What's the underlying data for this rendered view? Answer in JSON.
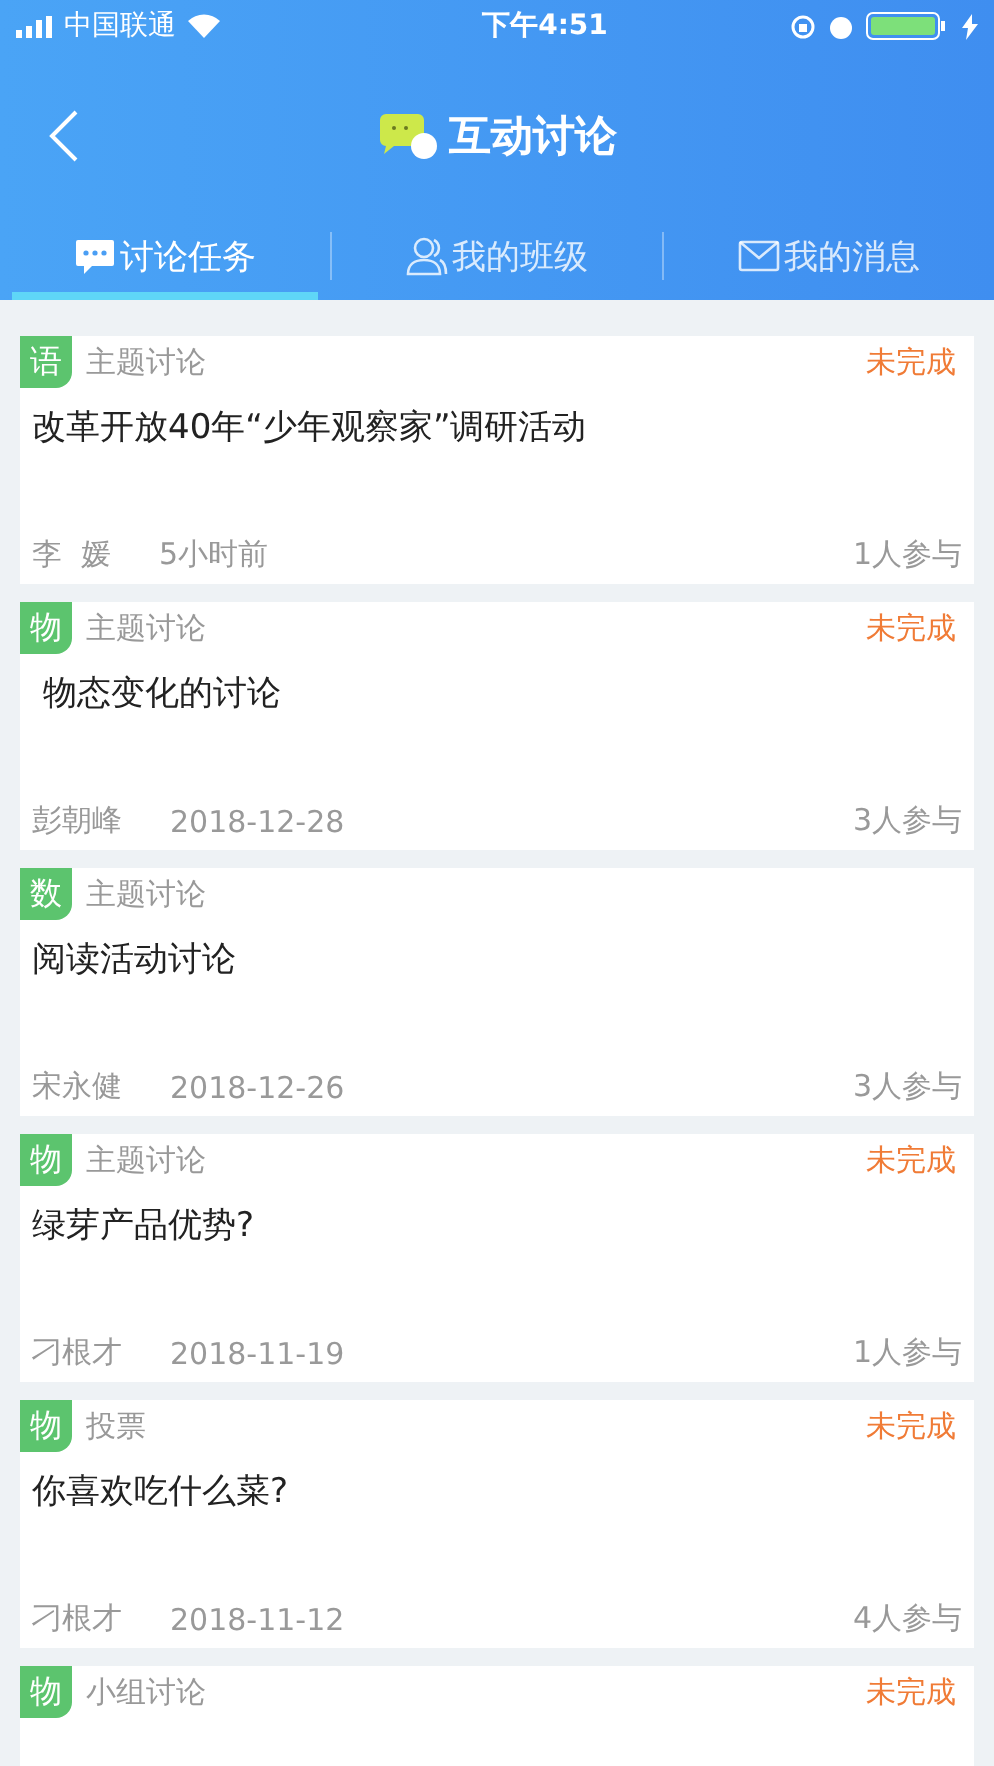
{
  "status_bar": {
    "carrier": "中国联通",
    "time": "下午4:51"
  },
  "header": {
    "title": "互动讨论"
  },
  "tabs": [
    {
      "label": "讨论任务",
      "selected": true
    },
    {
      "label": "我的班级",
      "selected": false
    },
    {
      "label": "我的消息",
      "selected": false
    }
  ],
  "tasks": [
    {
      "subject": "语",
      "type": "主题讨论",
      "status": "未完成",
      "title": "改革开放40年“少年观察家”调研活动",
      "author": "李  媛",
      "time": "5小时前",
      "participants": "1人参与"
    },
    {
      "subject": "物",
      "type": "主题讨论",
      "status": "未完成",
      "title": " 物态变化的讨论",
      "author": "彭朝峰",
      "time": "2018-12-28",
      "participants": "3人参与"
    },
    {
      "subject": "数",
      "type": "主题讨论",
      "title": "阅读活动讨论",
      "author": "宋永健",
      "time": "2018-12-26",
      "participants": "3人参与"
    },
    {
      "subject": "物",
      "type": "主题讨论",
      "status": "未完成",
      "title": "绿芽产品优势?",
      "author": "刁根才",
      "time": "2018-11-19",
      "participants": "1人参与"
    },
    {
      "subject": "物",
      "type": "投票",
      "status": "未完成",
      "title": "你喜欢吃什么菜?",
      "author": "刁根才",
      "time": "2018-11-12",
      "participants": "4人参与"
    },
    {
      "subject": "物",
      "type": "小组讨论",
      "status": "未完成"
    }
  ]
}
